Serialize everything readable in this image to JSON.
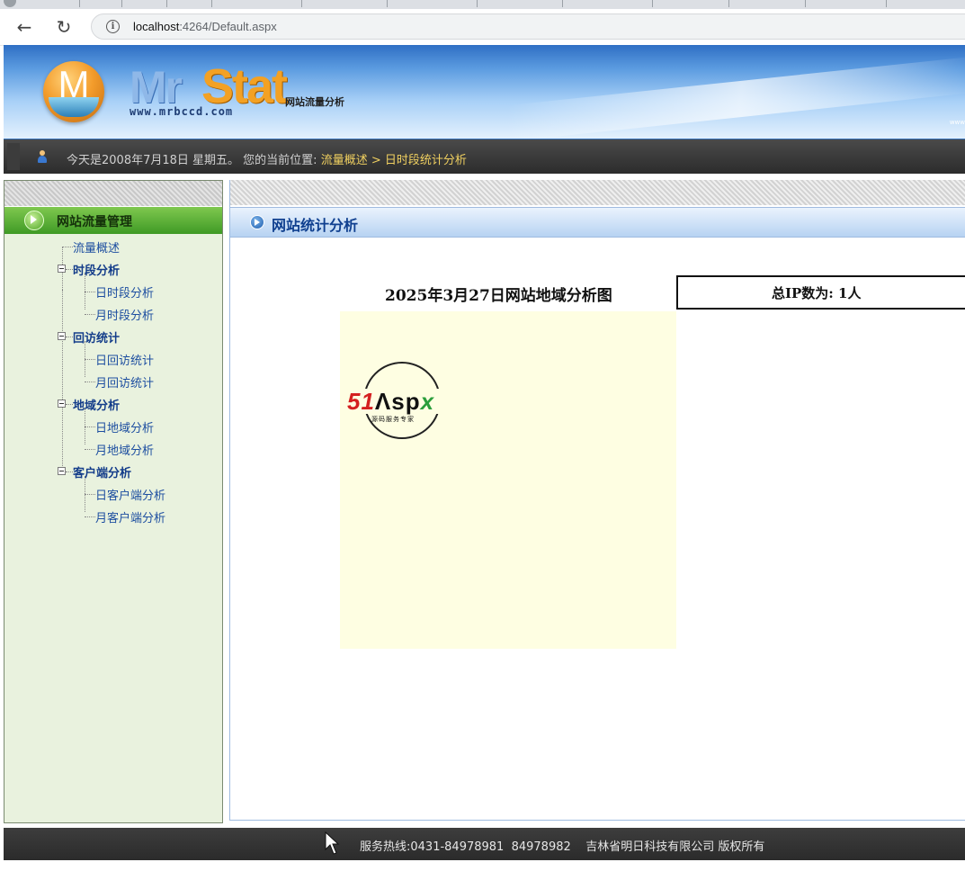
{
  "browser": {
    "back_glyph": "←",
    "reload_glyph": "↻",
    "info_glyph": "i",
    "url_host": "localhost",
    "url_rest": ":4264/Default.aspx"
  },
  "banner": {
    "logo_letter": "M",
    "logo_mr": "Mr",
    "logo_stat": "Stat",
    "logo_subtitle": "网站流量分析",
    "logo_url": "www.mrbccd.com",
    "right_text": "www"
  },
  "status": {
    "text": "今天是2008年7月18日 星期五。 您的当前位置: ",
    "location": "流量概述 > 日时段统计分析"
  },
  "sidebar": {
    "header": "网站流量管理",
    "items": [
      {
        "label": "流量概述"
      },
      {
        "label": "时段分析"
      },
      {
        "label": "日时段分析"
      },
      {
        "label": "月时段分析"
      },
      {
        "label": "回访统计"
      },
      {
        "label": "日回访统计"
      },
      {
        "label": "月回访统计"
      },
      {
        "label": "地域分析"
      },
      {
        "label": "日地域分析"
      },
      {
        "label": "月地域分析"
      },
      {
        "label": "客户端分析"
      },
      {
        "label": "日客户端分析"
      },
      {
        "label": "月客户端分析"
      }
    ]
  },
  "main": {
    "header": "网站统计分析",
    "chart_title": "2025年3月27日网站地域分析图",
    "ip_total": "总IP数为: 1人"
  },
  "watermark": {
    "brand_51": "51",
    "brand_a": "Λ",
    "brand_sp": "sp",
    "brand_x": "x",
    "tagline": "源码服务专家"
  },
  "footer": {
    "text": "服务热线:0431-84978981  84978982    吉林省明日科技有限公司 版权所有"
  }
}
